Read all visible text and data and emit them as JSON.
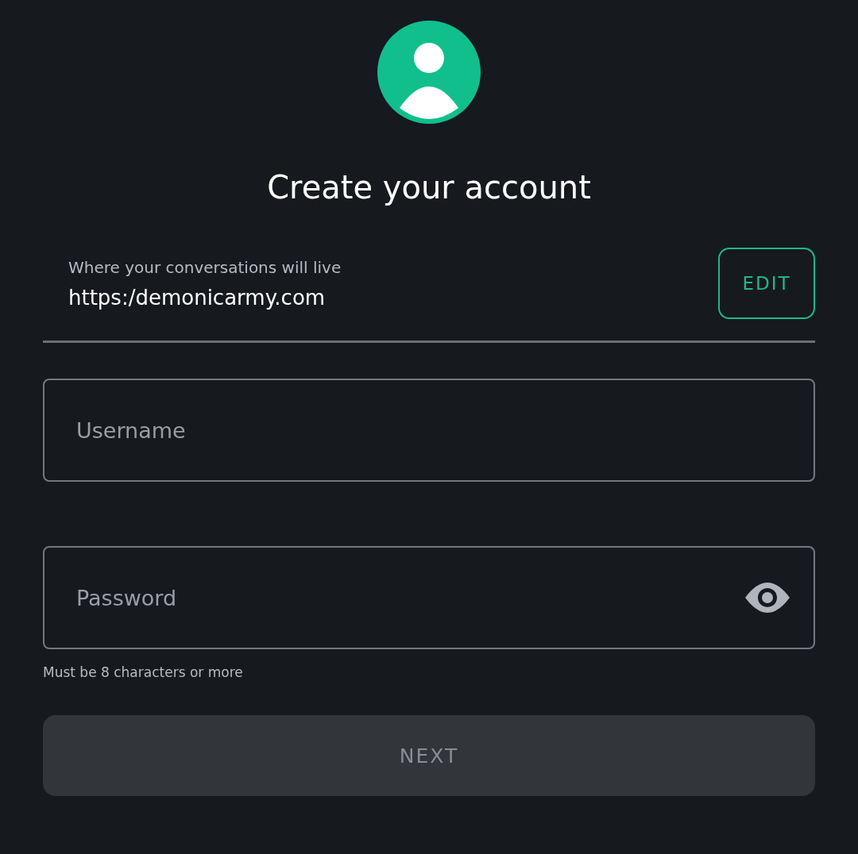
{
  "title": "Create your account",
  "server": {
    "label": "Where your conversations will live",
    "url": "https:/demonicarmy.com",
    "edit_button": "EDIT"
  },
  "fields": [
    {
      "kind": "text",
      "placeholder": "Username"
    },
    {
      "kind": "password",
      "placeholder": "Password",
      "hint": "Must be 8 characters or more"
    }
  ],
  "next_button": {
    "label": "NEXT",
    "disabled": true
  }
}
